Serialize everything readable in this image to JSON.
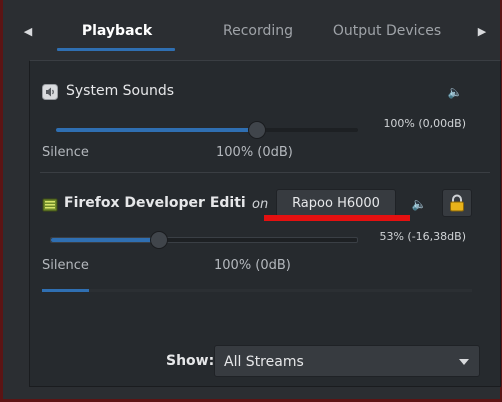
{
  "tabs": [
    {
      "label": "Playback",
      "active": true
    },
    {
      "label": "Recording",
      "active": false
    },
    {
      "label": "Output Devices",
      "active": false
    }
  ],
  "streams": [
    {
      "title": "System Sounds",
      "icon": "system-sounds-icon",
      "volume_percent": 100,
      "volume_text": "100% (0,00dB)",
      "mark_left": "Silence",
      "mark_right": "100% (0dB)"
    },
    {
      "title": "Firefox Developer Edition…",
      "icon": "firefox-app-icon",
      "on_label": "on",
      "device": "Rapoo H6000",
      "volume_percent": 53,
      "volume_text": "53% (-16,38dB)",
      "mark_left": "Silence",
      "mark_right": "100% (0dB)",
      "peak_level": 0.11
    }
  ],
  "footer": {
    "show_label": "Show:",
    "show_value": "All Streams"
  },
  "colors": {
    "accent": "#2f6fb2",
    "annotation": "#e41010",
    "lock": "#e8b21a"
  }
}
